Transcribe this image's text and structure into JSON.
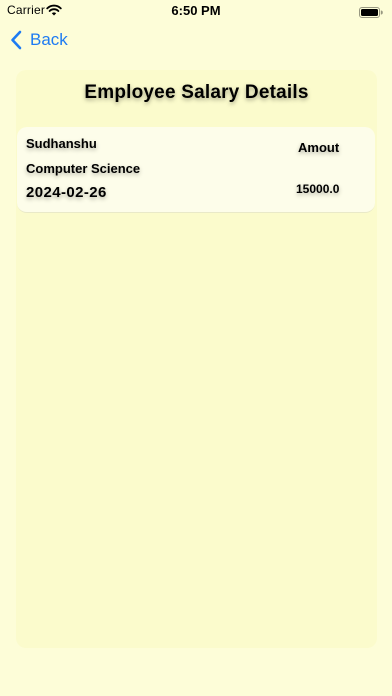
{
  "status_bar": {
    "carrier": "Carrier",
    "time": "6:50 PM"
  },
  "nav": {
    "back_label": "Back",
    "accent_color": "#1e7bf2"
  },
  "page": {
    "title": "Employee Salary Details",
    "background_color": "#fdfdd8"
  },
  "employee": {
    "name": "Sudhanshu",
    "department": "Computer Science",
    "date": "2024-02-26",
    "amount_label": "Amout",
    "amount_value": "15000.0"
  }
}
